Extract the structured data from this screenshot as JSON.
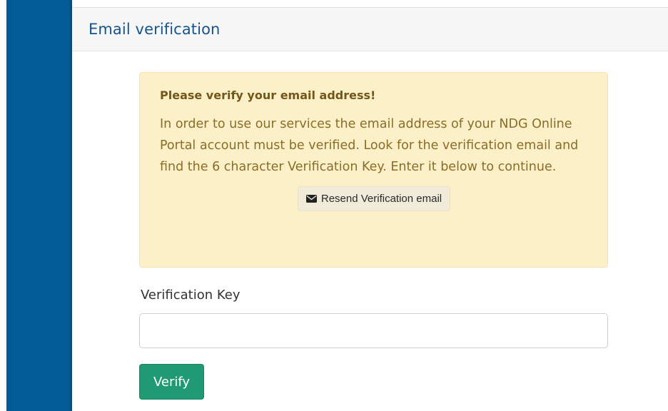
{
  "panel": {
    "title": "Email verification"
  },
  "alert": {
    "heading": "Please verify your email address!",
    "message": "In order to use our services the email address of your NDG Online Portal account must be verified. Look for the verification email and find the 6 character Verification Key. Enter it below to continue.",
    "resend_button": {
      "icon": "envelope-icon",
      "label": "Resend Verification email"
    }
  },
  "form": {
    "key_label": "Verification Key",
    "key_value": "",
    "key_placeholder": "",
    "verify_label": "Verify"
  },
  "colors": {
    "sidebar": "#005b96",
    "title": "#16548f",
    "alert_background": "#fcf0c9",
    "alert_text": "#8a6d28",
    "verify_button": "#1f9a72"
  }
}
